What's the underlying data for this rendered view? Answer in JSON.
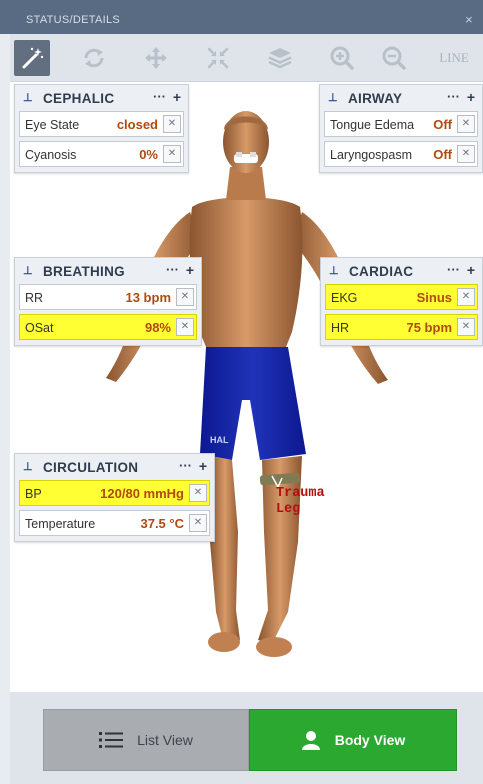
{
  "window": {
    "title": "STATUS/DETAILS",
    "close_glyph": "×"
  },
  "toolbar": {
    "tools": [
      {
        "name": "magic-wand-icon",
        "active": true
      },
      {
        "name": "rotate-icon",
        "active": false
      },
      {
        "name": "move-icon",
        "active": false
      },
      {
        "name": "collapse-icon",
        "active": false
      },
      {
        "name": "layers-icon",
        "active": false
      },
      {
        "name": "zoom-in-icon",
        "active": false
      },
      {
        "name": "zoom-out-icon",
        "active": false
      }
    ],
    "line_label": "LINE"
  },
  "panel_controls": {
    "pin": "⊥",
    "dots": "···",
    "plus": "+",
    "remove": "✕"
  },
  "panels": {
    "cephalic": {
      "title": "CEPHALIC",
      "rows": [
        {
          "label": "Eye State",
          "value": "closed",
          "highlight": false
        },
        {
          "label": "Cyanosis",
          "value": "0%",
          "highlight": false
        }
      ]
    },
    "airway": {
      "title": "AIRWAY",
      "rows": [
        {
          "label": "Tongue Edema",
          "value": "Off",
          "highlight": false
        },
        {
          "label": "Laryngospasm",
          "value": "Off",
          "highlight": false
        }
      ]
    },
    "breathing": {
      "title": "BREATHING",
      "rows": [
        {
          "label": "RR",
          "value": "13 bpm",
          "highlight": false
        },
        {
          "label": "OSat",
          "value": "98%",
          "highlight": true
        }
      ]
    },
    "cardiac": {
      "title": "CARDIAC",
      "rows": [
        {
          "label": "EKG",
          "value": "Sinus",
          "highlight": true
        },
        {
          "label": "HR",
          "value": "75 bpm",
          "highlight": true
        }
      ]
    },
    "circulation": {
      "title": "CIRCULATION",
      "rows": [
        {
          "label": "BP",
          "value": "120/80 mmHg",
          "highlight": true
        },
        {
          "label": "Temperature",
          "value": "37.5 °C",
          "highlight": false
        }
      ]
    }
  },
  "annotations": {
    "trauma_line1": "Trauma",
    "trauma_line2": "Leg",
    "shorts_logo": "HAL"
  },
  "footer": {
    "list_view": "List View",
    "body_view": "Body View"
  },
  "colors": {
    "value_text": "#b04a11",
    "highlight": "#ffff33",
    "body_view_bg": "#2aa830",
    "titlebar": "#586b83"
  }
}
